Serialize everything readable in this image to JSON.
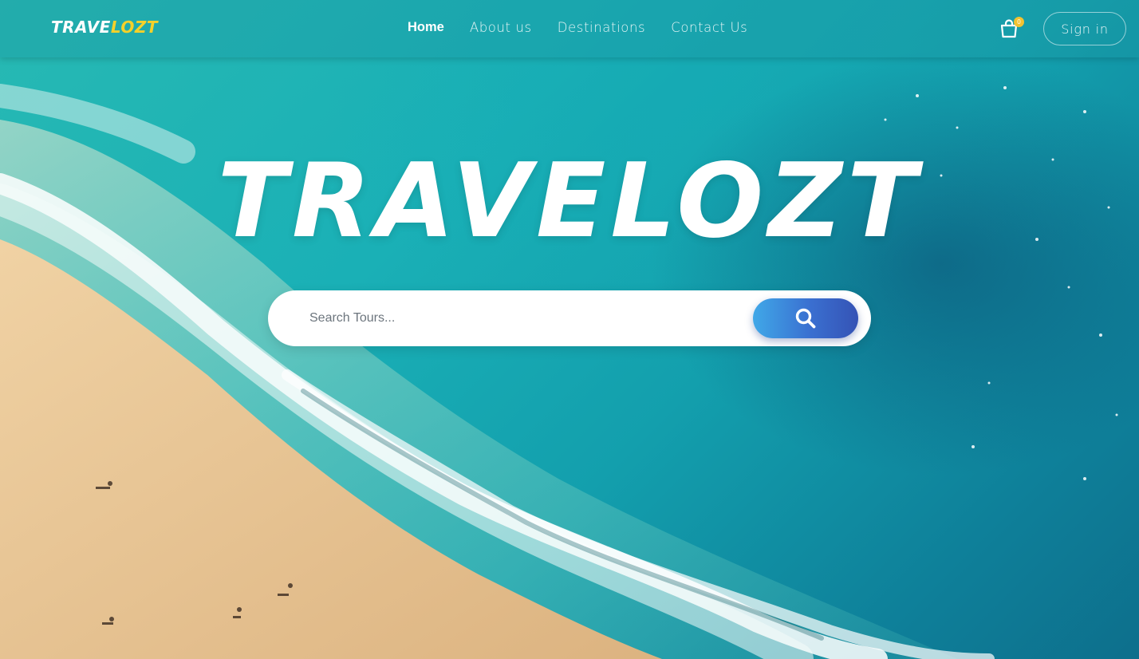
{
  "brand": {
    "logo_part_a": "TRAVE",
    "logo_part_b": "LOZT"
  },
  "nav": {
    "items": [
      {
        "label": "Home",
        "active": true
      },
      {
        "label": "About us"
      },
      {
        "label": "Destinations"
      },
      {
        "label": "Contact Us"
      }
    ],
    "cart_count": "0",
    "signin_label": "Sign in"
  },
  "hero": {
    "title": "TRAVELOZT",
    "search_placeholder": "Search Tours...",
    "search_value": ""
  },
  "colors": {
    "logo_accent": "#f5d12a",
    "cart_badge": "#f2c230",
    "search_button_start": "#40a8e8",
    "search_button_end": "#3553b5",
    "sea": "#1ab0b6",
    "sand": "#e6c494"
  },
  "icons": {
    "cart": "shopping-bag-icon",
    "search": "search-icon"
  }
}
